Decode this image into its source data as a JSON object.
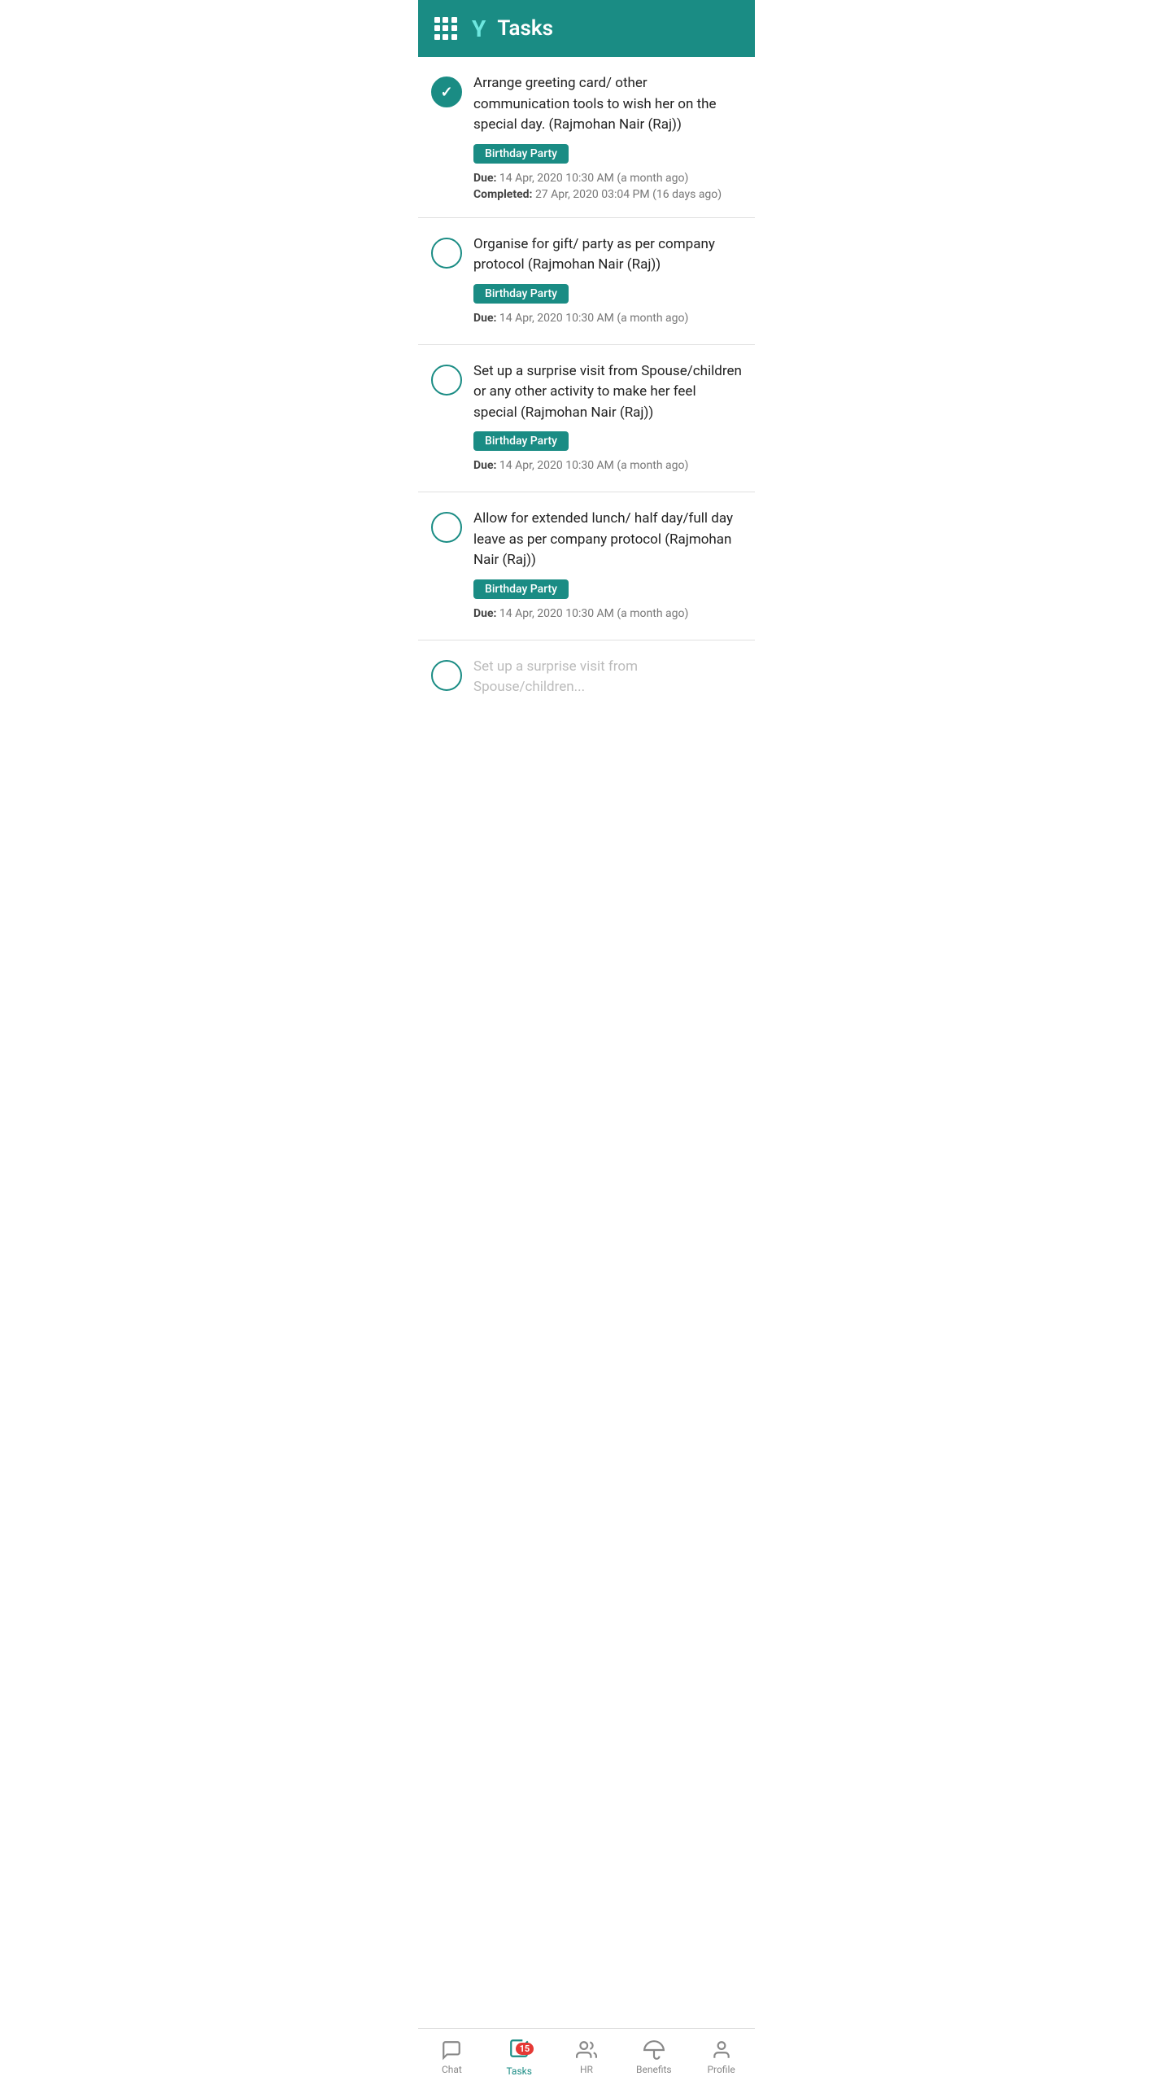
{
  "header": {
    "title": "Tasks",
    "logo_char": "Y"
  },
  "tasks": [
    {
      "id": 1,
      "completed": true,
      "title": "Arrange greeting card/ other communication tools to wish her on the special day. (Rajmohan Nair (Raj))",
      "tag": "Birthday Party",
      "due": "Due:",
      "due_date": "14 Apr, 2020 10:30 AM (a month ago)",
      "completed_label": "Completed:",
      "completed_date": "27 Apr, 2020 03:04 PM (16 days ago)"
    },
    {
      "id": 2,
      "completed": false,
      "title": "Organise for gift/ party as per company protocol (Rajmohan Nair (Raj))",
      "tag": "Birthday Party",
      "due": "Due:",
      "due_date": "14 Apr, 2020 10:30 AM (a month ago)",
      "completed_label": null,
      "completed_date": null
    },
    {
      "id": 3,
      "completed": false,
      "title": "Set up a surprise visit from Spouse/children or any other activity to make her feel special (Rajmohan Nair (Raj))",
      "tag": "Birthday Party",
      "due": "Due:",
      "due_date": "14 Apr, 2020 10:30 AM (a month ago)",
      "completed_label": null,
      "completed_date": null
    },
    {
      "id": 4,
      "completed": false,
      "title": "Allow for extended lunch/ half day/full day leave as per company protocol (Rajmohan Nair (Raj))",
      "tag": "Birthday Party",
      "due": "Due:",
      "due_date": "14 Apr, 2020 10:30 AM (a month ago)",
      "completed_label": null,
      "completed_date": null
    }
  ],
  "partial_task": {
    "title": "Set up a surprise visit from Spouse/children..."
  },
  "bottom_nav": {
    "items": [
      {
        "id": "chat",
        "label": "Chat",
        "active": false,
        "badge": null
      },
      {
        "id": "tasks",
        "label": "Tasks",
        "active": true,
        "badge": "15"
      },
      {
        "id": "hr",
        "label": "HR",
        "active": false,
        "badge": null
      },
      {
        "id": "benefits",
        "label": "Benefits",
        "active": false,
        "badge": null
      },
      {
        "id": "profile",
        "label": "Profile",
        "active": false,
        "badge": null
      }
    ]
  }
}
